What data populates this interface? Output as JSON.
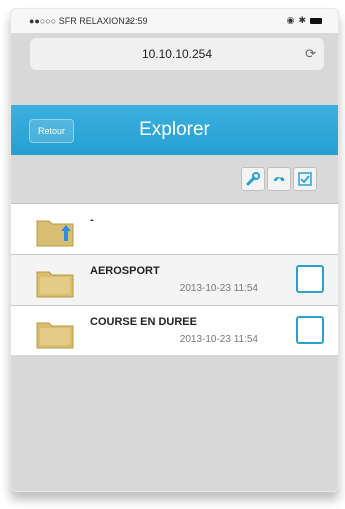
{
  "statusbar": {
    "carrier": "SFR RELAXION",
    "time": "22:59"
  },
  "address_bar": {
    "url": "10.10.10.254",
    "reload_icon": "reload-icon"
  },
  "navbar": {
    "back_label": "Retour",
    "title": "Explorer"
  },
  "toolbar": {
    "icons": [
      "wrench-icon",
      "cloud-upload-icon",
      "check-square-icon"
    ]
  },
  "list": {
    "items": [
      {
        "name": "-",
        "date": "",
        "icon": "folder-up-icon"
      },
      {
        "name": "AEROSPORT",
        "date": "2013-10-23 11:54",
        "icon": "folder-icon"
      },
      {
        "name": "COURSE EN DUREE",
        "date": "2013-10-23 11:54",
        "icon": "folder-icon"
      }
    ]
  },
  "colors": {
    "accent": "#2aa1d3",
    "navbar": "#259fd1"
  }
}
